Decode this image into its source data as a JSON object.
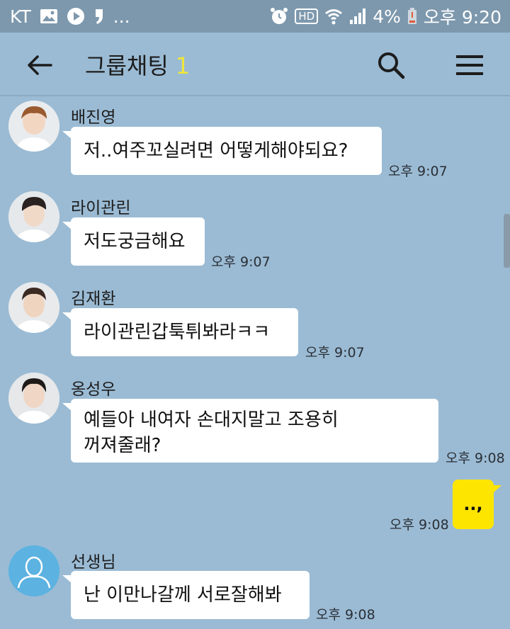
{
  "status_bar": {
    "carrier": "KT",
    "battery": "4%",
    "time": "오후 9:20",
    "hd_label": "HD",
    "dots": "..."
  },
  "header": {
    "title": "그룹채팅",
    "member_count": "1"
  },
  "messages": [
    {
      "sender": "배진영",
      "text": "저..여주꼬실려면 어떻게해야되요?",
      "time": "오후 9:07"
    },
    {
      "sender": "라이관린",
      "text": "저도궁금해요",
      "time": "오후 9:07"
    },
    {
      "sender": "김재환",
      "text": "라이관린갑툭튀봐라ㅋㅋ",
      "time": "오후 9:07"
    },
    {
      "sender": "옹성우",
      "lines": [
        "예들아 내여자 손대지말고 조용히",
        "꺼져줄래?"
      ],
      "time": "오후 9:08"
    },
    {
      "sender": "선생님",
      "text": "난 이만나갈께 서로잘해봐",
      "time": "오후 9:08"
    }
  ],
  "my_message": {
    "text": "..,",
    "time": "오후 9:08"
  },
  "colors": {
    "chat_background": "#9bbbd4",
    "status_bar": "#7d98ad",
    "my_bubble": "#fee500",
    "member_count": "#f0e63a"
  }
}
